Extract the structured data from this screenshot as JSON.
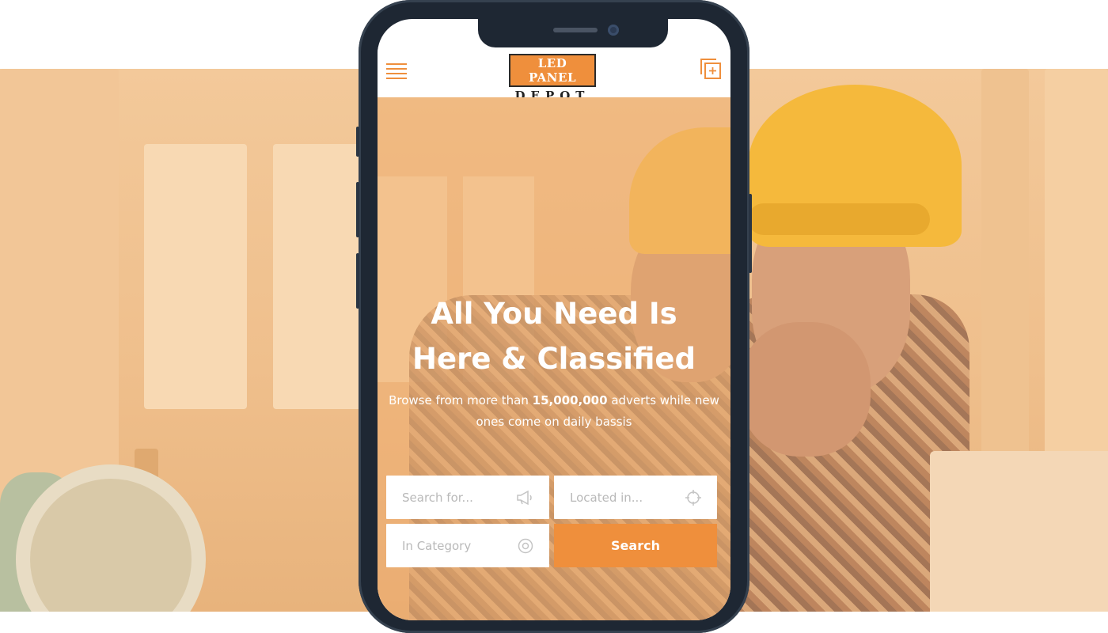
{
  "header": {
    "logo_line1": "LED PANEL",
    "logo_line2": "DEPOT",
    "menu_icon": "hamburger-menu-icon",
    "add_icon": "add-listing-icon"
  },
  "hero": {
    "title_line1": "All You Need Is",
    "title_line2": "Here & Classified",
    "subtitle_prefix": "Browse from more than ",
    "subtitle_count": "15,000,000",
    "subtitle_suffix": " adverts while new ones come on daily bassis"
  },
  "search_form": {
    "search_placeholder": "Search for...",
    "search_icon": "megaphone-icon",
    "location_placeholder": "Located in...",
    "location_icon": "crosshair-icon",
    "category_placeholder": "In Category",
    "category_icon": "target-icon",
    "submit_label": "Search"
  },
  "colors": {
    "accent": "#ef8f3c",
    "phone_frame": "#1e2733",
    "hero_overlay": "#f0b478"
  }
}
